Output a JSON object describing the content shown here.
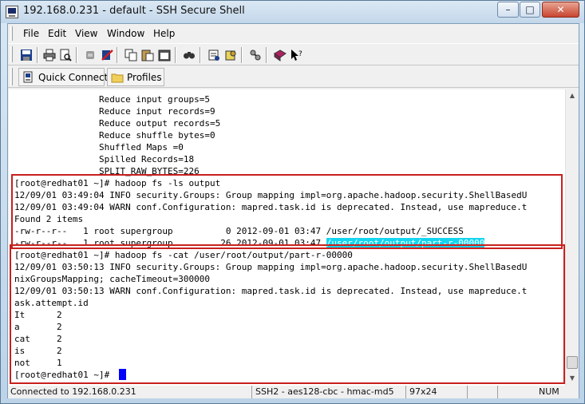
{
  "window": {
    "title": "192.168.0.231 - default - SSH Secure Shell"
  },
  "menu": [
    "File",
    "Edit",
    "View",
    "Window",
    "Help"
  ],
  "toolbar": {
    "icons": [
      "save-icon",
      "print-icon",
      "print-preview-icon",
      "disconnect-icon",
      "disconnect-red-icon",
      "copy-icon",
      "paste-icon",
      "paste-special-icon",
      "find-icon",
      "settings-icon",
      "profile-settings-icon",
      "keygen-icon",
      "help-book-icon",
      "whats-this-icon"
    ]
  },
  "quickbar": {
    "quick_connect": "Quick Connect",
    "profiles": "Profiles"
  },
  "terminal": {
    "lines": [
      "                Reduce input groups=5",
      "                Reduce input records=9",
      "                Reduce output records=5",
      "                Reduce shuffle bytes=0",
      "                Shuffled Maps =0",
      "                Spilled Records=18",
      "                SPLIT_RAW_BYTES=226",
      "[root@redhat01 ~]# hadoop fs -ls output",
      "12/09/01 03:49:04 INFO security.Groups: Group mapping impl=org.apache.hadoop.security.ShellBasedU",
      "12/09/01 03:49:04 WARN conf.Configuration: mapred.task.id is deprecated. Instead, use mapreduce.t",
      "Found 2 items",
      "-rw-r--r--   1 root supergroup          0 2012-09-01 03:47 /user/root/output/_SUCCESS",
      "-rw-r--r--   1 root supergroup         26 2012-09-01 03:47 ",
      "[root@redhat01 ~]# hadoop fs -cat /user/root/output/part-r-00000",
      "12/09/01 03:50:13 INFO security.Groups: Group mapping impl=org.apache.hadoop.security.ShellBasedU",
      "nixGroupsMapping; cacheTimeout=300000",
      "12/09/01 03:50:13 WARN conf.Configuration: mapred.task.id is deprecated. Instead, use mapreduce.t",
      "ask.attempt.id",
      "It      2",
      "a       2",
      "cat     2",
      "is      2",
      "not     1",
      "[root@redhat01 ~]# "
    ],
    "selected_text": "/user/root/output/part-r-00000"
  },
  "status": {
    "connection": "Connected to 192.168.0.231",
    "cipher": "SSH2 - aes128-cbc - hmac-md5",
    "size": "97x24",
    "mode": "NUM"
  }
}
